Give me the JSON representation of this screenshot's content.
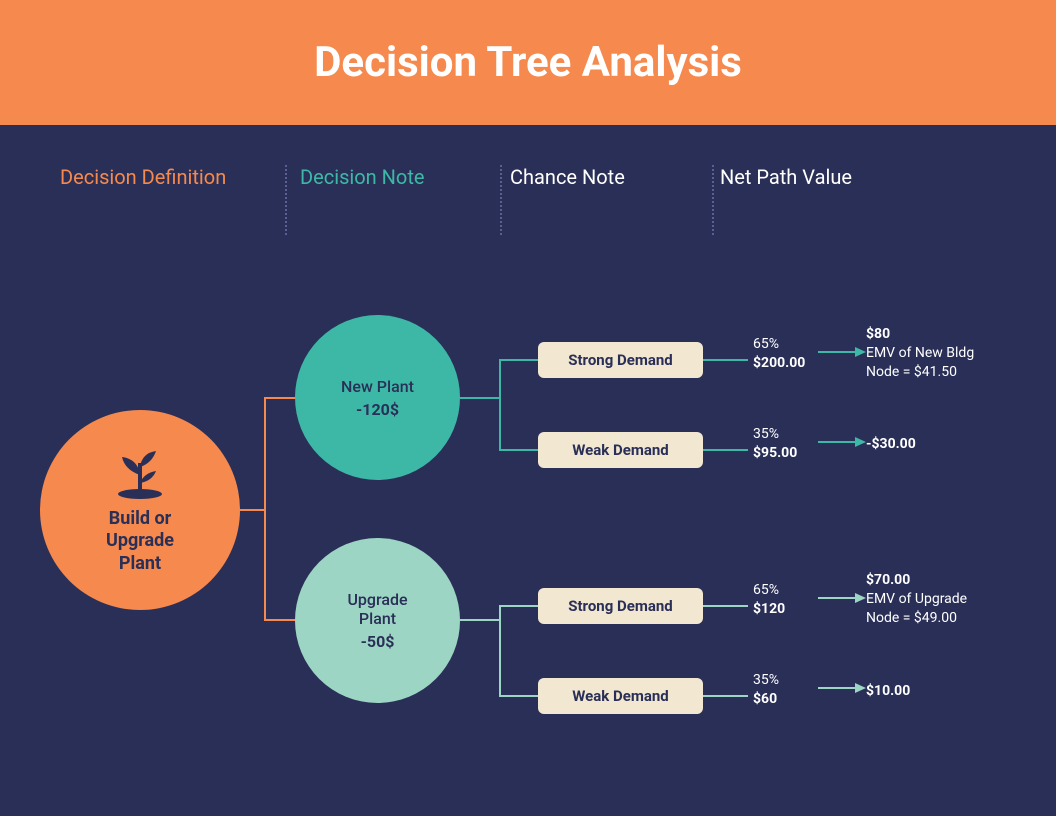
{
  "header": {
    "title": "Decision Tree Analysis"
  },
  "columns": {
    "c1": "Decision Definition",
    "c2": "Decision Note",
    "c3": "Chance Note",
    "c4": "Net Path Value"
  },
  "root": {
    "label": "Build or\nUpgrade\nPlant"
  },
  "decisions": {
    "new": {
      "name": "New Plant",
      "cost": "-120$"
    },
    "upg": {
      "name": "Upgrade\nPlant",
      "cost": "-50$"
    }
  },
  "chances": {
    "c1": {
      "label": "Strong Demand",
      "pct": "65%",
      "amt": "$200.00"
    },
    "c2": {
      "label": "Weak Demand",
      "pct": "35%",
      "amt": "$95.00"
    },
    "c3": {
      "label": "Strong Demand",
      "pct": "65%",
      "amt": "$120"
    },
    "c4": {
      "label": "Weak Demand",
      "pct": "35%",
      "amt": "$60"
    }
  },
  "net": {
    "n1": {
      "primary": "$80",
      "secondary": "EMV of New Bldg\nNode = $41.50"
    },
    "n2": {
      "primary": "-$30.00",
      "secondary": ""
    },
    "n3": {
      "primary": "$70.00",
      "secondary": "EMV of Upgrade\nNode = $49.00"
    },
    "n4": {
      "primary": "$10.00",
      "secondary": ""
    }
  },
  "colors": {
    "orange": "#f5894e",
    "teal": "#3eb8a6",
    "mint": "#9dd5c4",
    "navy": "#2a2f57",
    "cream": "#f2e7d0"
  }
}
